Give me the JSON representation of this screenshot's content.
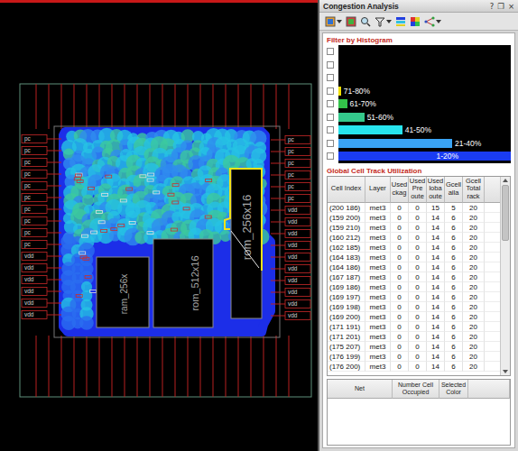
{
  "layout_view": {
    "left_pins": [
      "pc",
      "pc",
      "pc",
      "pc",
      "pc",
      "pc",
      "pc",
      "pc",
      "pc",
      "pc",
      "vdd",
      "vdd",
      "vdd",
      "vdd",
      "vdd",
      "vdd"
    ],
    "right_pins": [
      "pc",
      "pc",
      "pc",
      "pc",
      "pc",
      "pc",
      "vdd",
      "vdd",
      "vdd",
      "vdd",
      "vdd",
      "vdd",
      "vdd",
      "vdd",
      "vdd",
      "vdd"
    ],
    "macros": [
      {
        "name": "ram_256x",
        "selected": false
      },
      {
        "name": "rom_512x16",
        "selected": false
      },
      {
        "name": "rom_256x16",
        "selected": true
      }
    ]
  },
  "panel": {
    "title": "Congestion Analysis",
    "title_buttons": [
      "?",
      "❐",
      "×"
    ]
  },
  "histogram": {
    "title": "Filter by Histogram",
    "bins": [
      {
        "label": "",
        "checked": false,
        "level": 0,
        "color": "#000000"
      },
      {
        "label": "",
        "checked": false,
        "level": 0,
        "color": "#000000"
      },
      {
        "label": "",
        "checked": false,
        "level": 0,
        "color": "#000000"
      },
      {
        "label": "71-80%",
        "checked": false,
        "level": 0.015,
        "color": "#f0e000"
      },
      {
        "label": "61-70%",
        "checked": false,
        "level": 0.05,
        "color": "#33c24a"
      },
      {
        "label": "51-60%",
        "checked": false,
        "level": 0.15,
        "color": "#34c98c"
      },
      {
        "label": "41-50%",
        "checked": false,
        "level": 0.37,
        "color": "#27e4ee"
      },
      {
        "label": "21-40%",
        "checked": false,
        "level": 0.66,
        "color": "#3aa4f4"
      },
      {
        "label": "1-20%",
        "checked": false,
        "level": 1,
        "color": "#1a3cf2"
      }
    ]
  },
  "track_table": {
    "title": "Global Cell Track Utilization",
    "columns": [
      "Cell Index",
      "Layer",
      "Used ckag",
      "Used Pre oute",
      "Used loba oute",
      "Gcell aila",
      "Gcell Total rack"
    ],
    "rows": [
      {
        "cells": [
          "(200 186)",
          "met3",
          "0",
          "0",
          "15",
          "5",
          "20"
        ],
        "selected": false
      },
      {
        "cells": [
          "(159 200)",
          "met3",
          "0",
          "0",
          "14",
          "6",
          "20"
        ],
        "selected": false
      },
      {
        "cells": [
          "(159 210)",
          "met3",
          "0",
          "0",
          "14",
          "6",
          "20"
        ],
        "selected": false
      },
      {
        "cells": [
          "(160 212)",
          "met3",
          "0",
          "0",
          "14",
          "6",
          "20"
        ],
        "selected": false
      },
      {
        "cells": [
          "(162 185)",
          "met3",
          "0",
          "0",
          "14",
          "6",
          "20"
        ],
        "selected": false
      },
      {
        "cells": [
          "(164 183)",
          "met3",
          "0",
          "0",
          "14",
          "6",
          "20"
        ],
        "selected": false
      },
      {
        "cells": [
          "(164 186)",
          "met3",
          "0",
          "0",
          "14",
          "6",
          "20"
        ],
        "selected": false
      },
      {
        "cells": [
          "(167 187)",
          "met3",
          "0",
          "0",
          "14",
          "6",
          "20"
        ],
        "selected": false
      },
      {
        "cells": [
          "(169 186)",
          "met3",
          "0",
          "0",
          "14",
          "6",
          "20"
        ],
        "selected": false
      },
      {
        "cells": [
          "(169 197)",
          "met3",
          "0",
          "0",
          "14",
          "6",
          "20"
        ],
        "selected": false
      },
      {
        "cells": [
          "(169 198)",
          "met3",
          "0",
          "0",
          "14",
          "6",
          "20"
        ],
        "selected": false
      },
      {
        "cells": [
          "(169 200)",
          "met3",
          "0",
          "0",
          "14",
          "6",
          "20"
        ],
        "selected": false
      },
      {
        "cells": [
          "(171 191)",
          "met3",
          "0",
          "0",
          "14",
          "6",
          "20"
        ],
        "selected": false
      },
      {
        "cells": [
          "(171 201)",
          "met3",
          "0",
          "0",
          "14",
          "6",
          "20"
        ],
        "selected": false
      },
      {
        "cells": [
          "(175 207)",
          "met3",
          "0",
          "0",
          "14",
          "6",
          "20"
        ],
        "selected": false
      },
      {
        "cells": [
          "(176 199)",
          "met3",
          "0",
          "0",
          "14",
          "6",
          "20"
        ],
        "selected": false
      },
      {
        "cells": [
          "(176 200)",
          "met3",
          "0",
          "0",
          "14",
          "6",
          "20"
        ],
        "selected": false
      }
    ]
  },
  "net_table": {
    "columns": [
      "Net",
      "Number Cell Occupied",
      "Selected Color"
    ]
  }
}
